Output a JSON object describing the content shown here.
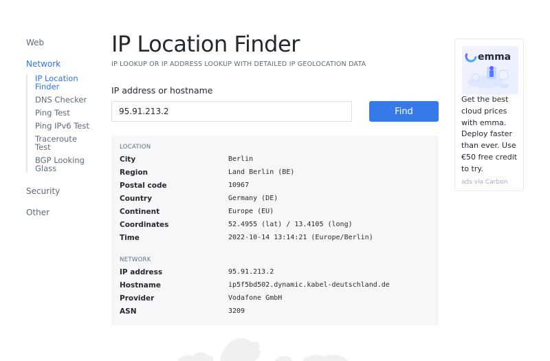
{
  "sidebar": {
    "web": "Web",
    "network": "Network",
    "network_items": [
      "IP Location Finder",
      "DNS Checker",
      "Ping Test",
      "Ping IPv6 Test",
      "Traceroute Test",
      "BGP Looking Glass"
    ],
    "security": "Security",
    "other": "Other",
    "active_color": "#2f74e6"
  },
  "main": {
    "title": "IP Location Finder",
    "subtitle": "IP LOOKUP OR IP ADDRESS LOOKUP WITH DETAILED IP GEOLOCATION DATA",
    "field_label": "IP address or hostname",
    "input_value": "95.91.213.2",
    "find_label": "Find",
    "button_color": "#3679e8"
  },
  "location": {
    "heading": "LOCATION",
    "rows": [
      {
        "key": "City",
        "value": "Berlin"
      },
      {
        "key": "Region",
        "value": "Land Berlin (BE)"
      },
      {
        "key": "Postal code",
        "value": "10967"
      },
      {
        "key": "Country",
        "value": "Germany (DE)"
      },
      {
        "key": "Continent",
        "value": "Europe (EU)"
      },
      {
        "key": "Coordinates",
        "value": "52.4955 (lat) / 13.4105 (long)"
      },
      {
        "key": "Time",
        "value": "2022-10-14 13:14:21 (Europe/Berlin)"
      }
    ]
  },
  "network": {
    "heading": "NETWORK",
    "rows": [
      {
        "key": "IP address",
        "value": "95.91.213.2"
      },
      {
        "key": "Hostname",
        "value": "ip5f5bd502.dynamic.kabel-deutschland.de"
      },
      {
        "key": "Provider",
        "value": "Vodafone GmbH"
      },
      {
        "key": "ASN",
        "value": "3209"
      }
    ]
  },
  "ad": {
    "brand": "emma",
    "text": "Get the best cloud prices with emma. Deploy faster than ever. Use €50 free credit to try.",
    "via": "ads via Carbon"
  }
}
